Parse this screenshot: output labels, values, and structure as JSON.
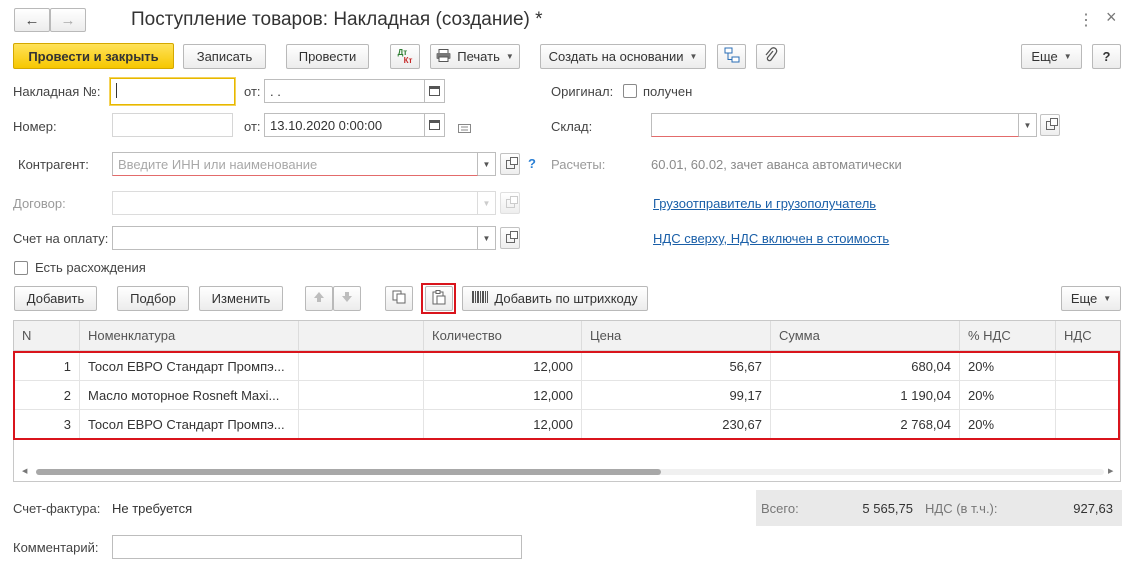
{
  "window": {
    "title": "Поступление товаров: Накладная (создание) *",
    "nav_back": "←",
    "nav_forward": "→",
    "menu_icon": "⋮",
    "close_icon": "×"
  },
  "toolbar": {
    "post_and_close": "Провести и закрыть",
    "save": "Записать",
    "post": "Провести",
    "dtkt_top": "Дт",
    "dtkt_bottom": "Кт",
    "print": "Печать",
    "create_based_on": "Создать на основании",
    "more": "Еще",
    "help": "?"
  },
  "header": {
    "invoice_no_label": "Накладная №:",
    "invoice_no_value": "",
    "from_label": "от:",
    "invoice_date_value": " .  .",
    "number_label": "Номер:",
    "number_value": "",
    "doc_date_value": "13.10.2020  0:00:00",
    "original_label": "Оригинал:",
    "original_received_label": "получен",
    "warehouse_label": "Склад:",
    "warehouse_value": "",
    "counterparty_label": "Контрагент:",
    "counterparty_placeholder": "Введите ИНН или наименование",
    "help_q": "?",
    "settlements_label": "Расчеты:",
    "settlements_value": "60.01, 60.02, зачет аванса автоматически",
    "contract_label": "Договор:",
    "contract_value": "",
    "shipper_link": "Грузоотправитель и грузополучатель",
    "payment_invoice_label": "Счет на оплату:",
    "payment_invoice_value": "",
    "vat_link": "НДС сверху, НДС включен в стоимость",
    "discrepancies_label": "Есть расхождения"
  },
  "table_toolbar": {
    "add": "Добавить",
    "pick": "Подбор",
    "change": "Изменить",
    "add_barcode": "Добавить по штрихкоду",
    "more": "Еще"
  },
  "table": {
    "headers": [
      "N",
      "Номенклатура",
      "",
      "Количество",
      "Цена",
      "Сумма",
      "% НДС",
      "НДС"
    ],
    "rows": [
      {
        "n": "1",
        "item": "Тосол ЕВРО Стандарт Промпэ...",
        "qty": "12,000",
        "price": "56,67",
        "sum": "680,04",
        "vat_rate": "20%"
      },
      {
        "n": "2",
        "item": "Масло моторное Rosneft Maxi...",
        "qty": "12,000",
        "price": "99,17",
        "sum": "1 190,04",
        "vat_rate": "20%"
      },
      {
        "n": "3",
        "item": "Тосол ЕВРО Стандарт Промпэ...",
        "qty": "12,000",
        "price": "230,67",
        "sum": "2 768,04",
        "vat_rate": "20%"
      }
    ]
  },
  "footer": {
    "invoice_label": "Счет-фактура:",
    "invoice_value": "Не требуется",
    "comment_label": "Комментарий:",
    "comment_value": "",
    "total_label": "Всего:",
    "total_value": "5 565,75",
    "vat_label": "НДС (в т.ч.):",
    "vat_value": "927,63"
  },
  "colors": {
    "primary_button": "#f6c700",
    "highlight_border": "#d9141c",
    "link": "#1a5fa8"
  }
}
